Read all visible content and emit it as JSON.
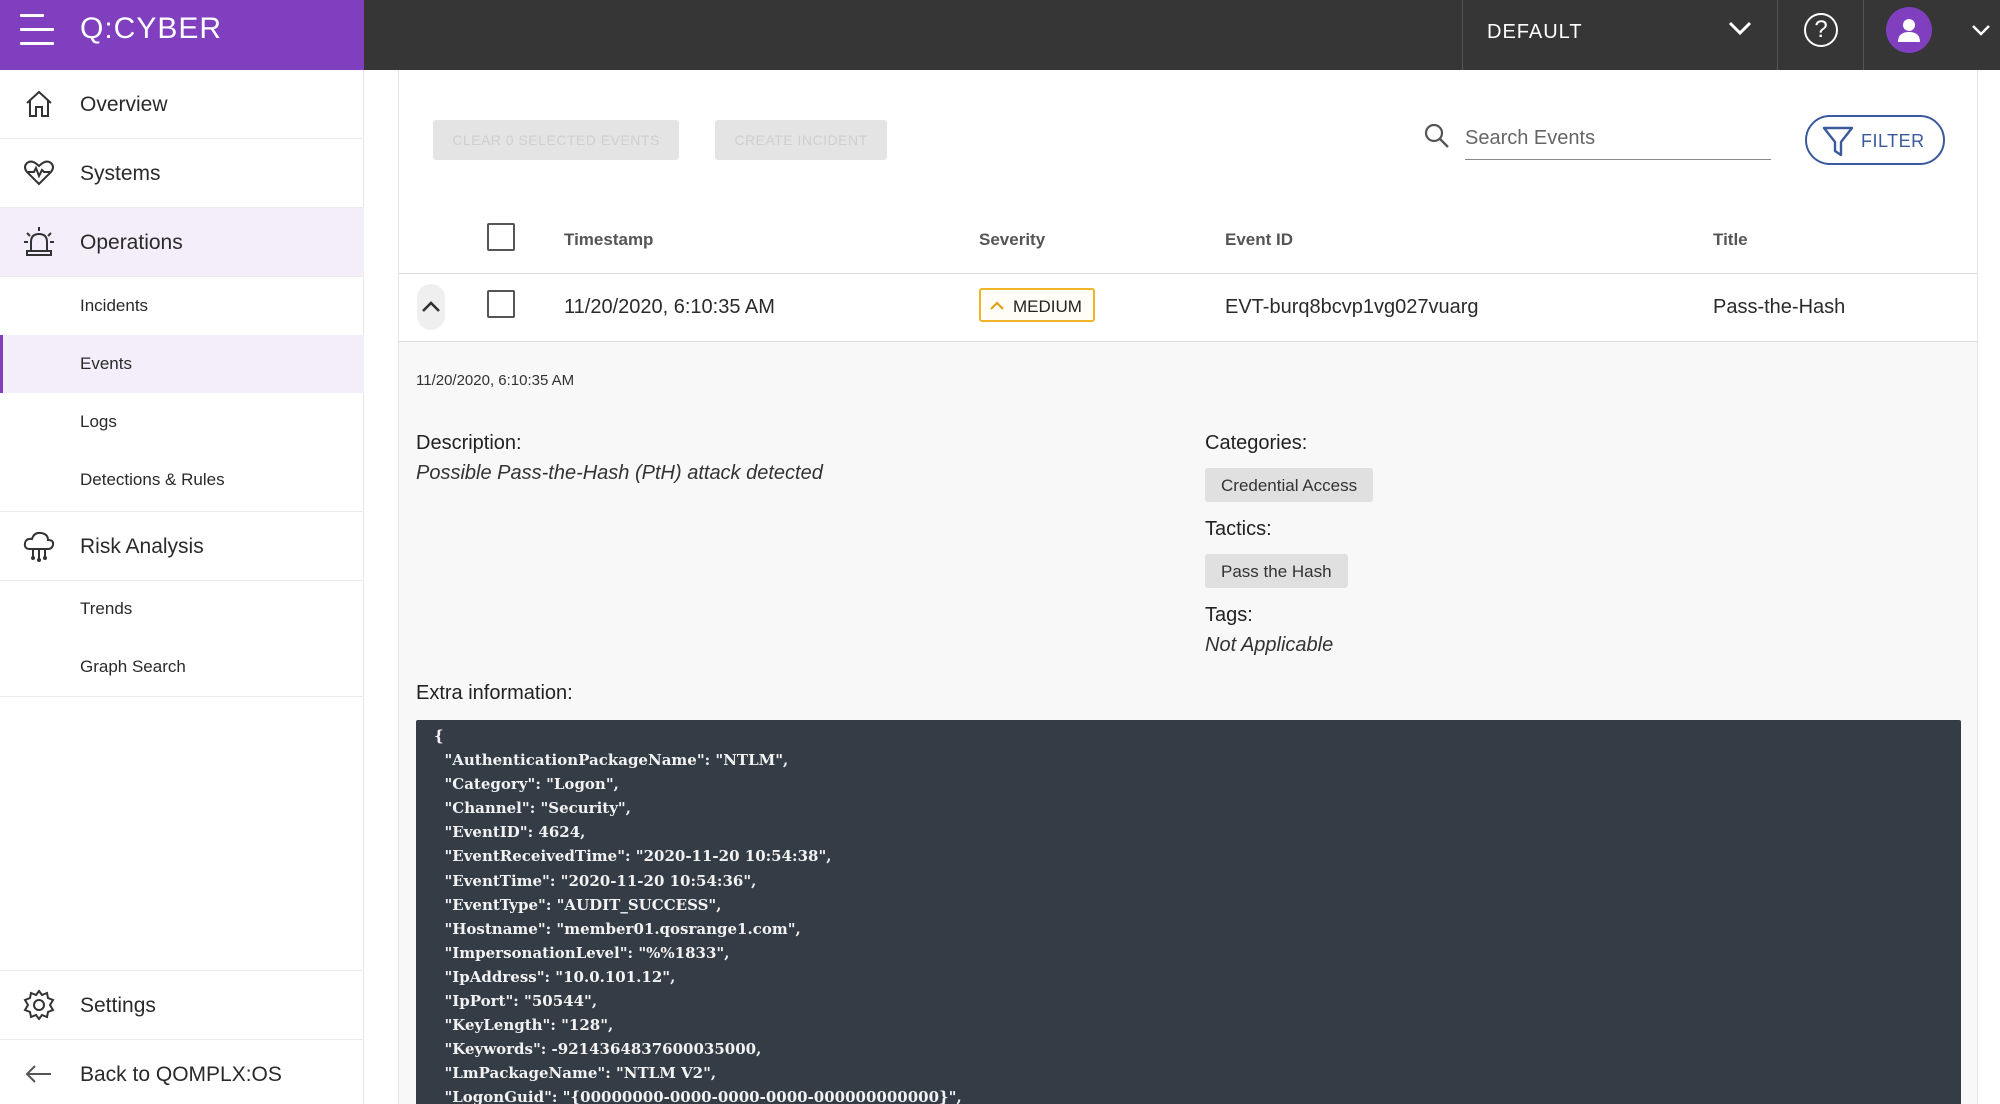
{
  "header": {
    "logo": "Q:CYBER",
    "tenant": "DEFAULT",
    "help_glyph": "?"
  },
  "sidebar": {
    "overview": "Overview",
    "systems": "Systems",
    "operations": "Operations",
    "incidents": "Incidents",
    "events": "Events",
    "logs": "Logs",
    "detections": "Detections & Rules",
    "risk_analysis": "Risk Analysis",
    "trends": "Trends",
    "graph_search": "Graph Search",
    "settings": "Settings",
    "back": "Back to QOMPLX:OS"
  },
  "toolbar": {
    "clear_label": "CLEAR 0 SELECTED EVENTS",
    "incident_label": "CREATE INCIDENT",
    "search_placeholder": "Search Events",
    "filter_label": "FILTER"
  },
  "table": {
    "headers": {
      "timestamp": "Timestamp",
      "severity": "Severity",
      "event_id": "Event ID",
      "title": "Title"
    },
    "row": {
      "timestamp": "11/20/2020, 6:10:35 AM",
      "severity": "MEDIUM",
      "event_id": "EVT-burq8bcvp1vg027vuarg",
      "title": "Pass-the-Hash"
    }
  },
  "detail": {
    "timestamp": "11/20/2020, 6:10:35 AM",
    "description_label": "Description:",
    "description": "Possible Pass-the-Hash (PtH) attack detected",
    "categories_label": "Categories:",
    "category": "Credential Access",
    "tactics_label": "Tactics:",
    "tactic": "Pass the Hash",
    "tags_label": "Tags:",
    "tags": "Not Applicable",
    "extra_label": "Extra information:",
    "extra_json": "{\n  \"AuthenticationPackageName\": \"NTLM\",\n  \"Category\": \"Logon\",\n  \"Channel\": \"Security\",\n  \"EventID\": 4624,\n  \"EventReceivedTime\": \"2020-11-20 10:54:38\",\n  \"EventTime\": \"2020-11-20 10:54:36\",\n  \"EventType\": \"AUDIT_SUCCESS\",\n  \"Hostname\": \"member01.qosrange1.com\",\n  \"ImpersonationLevel\": \"%%1833\",\n  \"IpAddress\": \"10.0.101.12\",\n  \"IpPort\": \"50544\",\n  \"KeyLength\": \"128\",\n  \"Keywords\": -9214364837600035000,\n  \"LmPackageName\": \"NTLM V2\",\n  \"LogonGuid\": \"{00000000-0000-0000-0000-000000000000}\","
  },
  "colors": {
    "brand": "#7f3fbf",
    "topbar": "#363636",
    "severity_medium": "#f0b429",
    "filter": "#3a5a9c"
  }
}
